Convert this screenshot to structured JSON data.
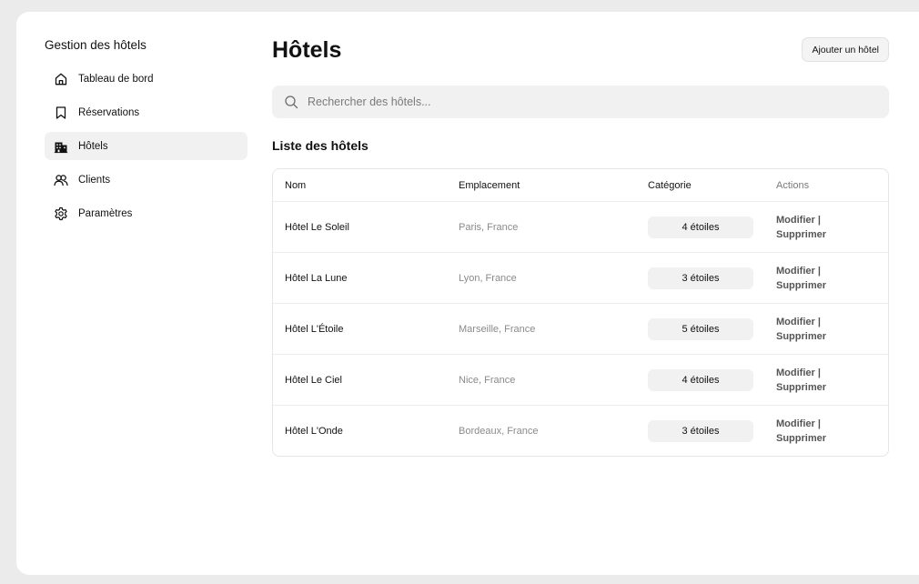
{
  "sidebar": {
    "title": "Gestion des hôtels",
    "items": [
      {
        "label": "Tableau de bord",
        "icon": "home-icon",
        "active": false
      },
      {
        "label": "Réservations",
        "icon": "bookmark-icon",
        "active": false
      },
      {
        "label": "Hôtels",
        "icon": "building-icon",
        "active": true
      },
      {
        "label": "Clients",
        "icon": "users-icon",
        "active": false
      },
      {
        "label": "Paramètres",
        "icon": "gear-icon",
        "active": false
      }
    ]
  },
  "main": {
    "title": "Hôtels",
    "add_button": "Ajouter un hôtel",
    "search_placeholder": "Rechercher des hôtels...",
    "section_title": "Liste des hôtels",
    "table": {
      "headers": [
        "Nom",
        "Emplacement",
        "Catégorie",
        "Actions"
      ],
      "rows": [
        {
          "name": "Hôtel Le Soleil",
          "location": "Paris, France",
          "category": "4 étoiles"
        },
        {
          "name": "Hôtel La Lune",
          "location": "Lyon, France",
          "category": "3 étoiles"
        },
        {
          "name": "Hôtel L'Étoile",
          "location": "Marseille, France",
          "category": "5 étoiles"
        },
        {
          "name": "Hôtel Le Ciel",
          "location": "Nice, France",
          "category": "4 étoiles"
        },
        {
          "name": "Hôtel L'Onde",
          "location": "Bordeaux, France",
          "category": "3 étoiles"
        }
      ],
      "edit_label": "Modifier",
      "separator": "|",
      "delete_label": "Supprimer"
    }
  }
}
